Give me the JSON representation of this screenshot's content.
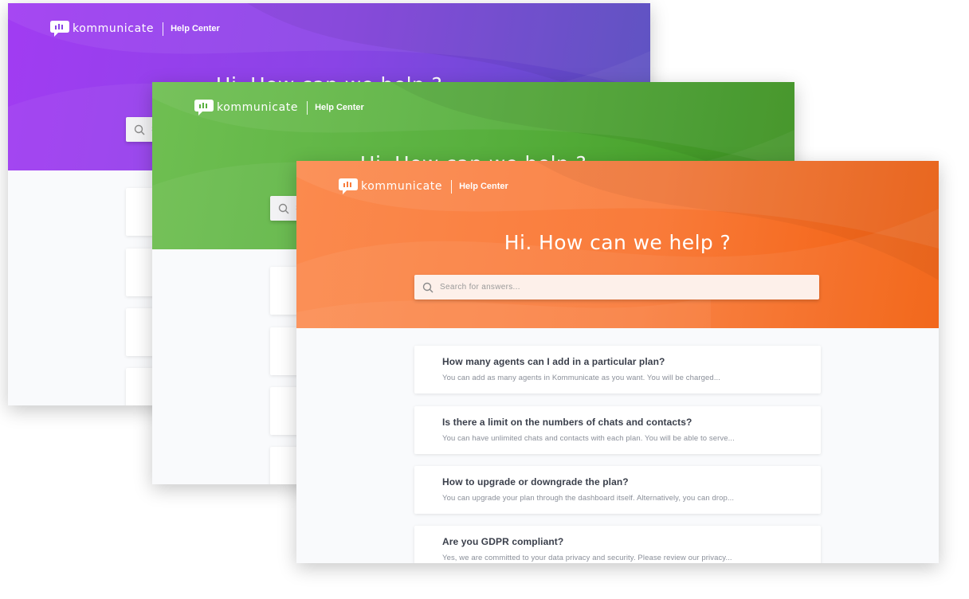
{
  "brand": {
    "logo_text": "kommunicate",
    "section": "Help Center"
  },
  "hero": {
    "headline": "Hi. How can we help ?"
  },
  "search": {
    "placeholder": "Search for answers..."
  },
  "theme_colors": {
    "purple": "#8a44e6",
    "green": "#58b03e",
    "orange": "#f97b3a"
  },
  "faqs": [
    {
      "question": "How many agents can I add in a particular plan?",
      "answer": "You can add as many agents in Kommunicate as you want. You will be charged..."
    },
    {
      "question": "Is there a limit on the numbers of chats and contacts?",
      "answer": "You can have unlimited chats and contacts with each plan. You will be able to serve..."
    },
    {
      "question": "How to upgrade or downgrade the plan?",
      "answer": "You can upgrade your plan through the dashboard itself. Alternatively, you can drop..."
    },
    {
      "question": "Are you GDPR compliant?",
      "answer": "Yes, we are committed to your data privacy and security. Please review our privacy..."
    }
  ]
}
